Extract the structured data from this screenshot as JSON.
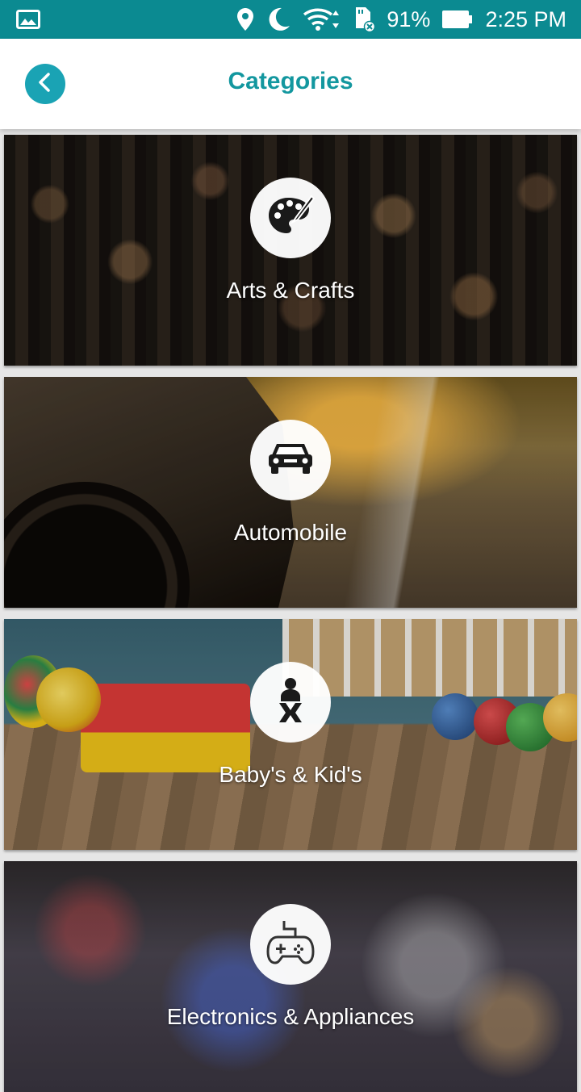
{
  "status_bar": {
    "battery": "91%",
    "time": "2:25 PM",
    "icons": [
      "gallery-icon",
      "location-icon",
      "moon-icon",
      "wifi-icon",
      "sd-card-icon",
      "battery-icon"
    ]
  },
  "header": {
    "title": "Categories",
    "back_icon": "chevron-left-icon",
    "colors": {
      "accent": "#13979f",
      "back_button": "#1aa3b4",
      "status_bar": "#0b8a91"
    }
  },
  "categories": [
    {
      "label": "Arts & Crafts",
      "icon": "palette-icon"
    },
    {
      "label": "Automobile",
      "icon": "car-icon"
    },
    {
      "label": "Baby's & Kid's",
      "icon": "baby-icon"
    },
    {
      "label": "Electronics & Appliances",
      "icon": "gamepad-icon"
    }
  ]
}
